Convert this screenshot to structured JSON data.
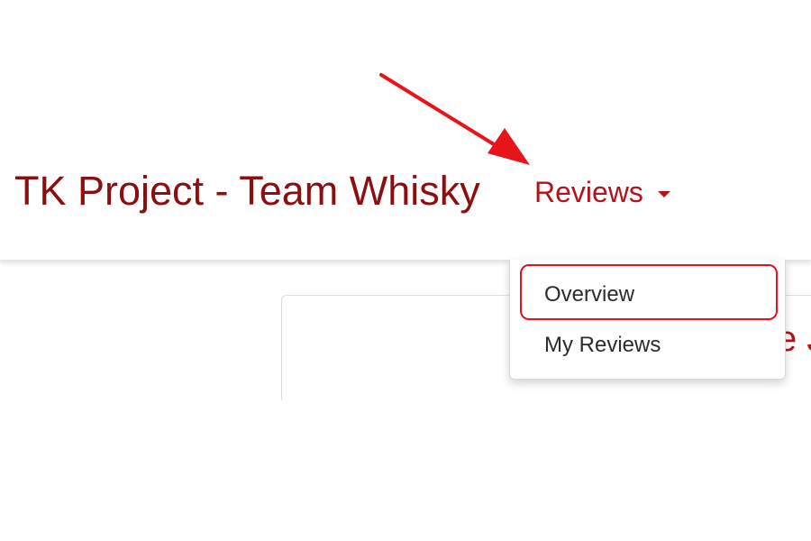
{
  "navbar": {
    "brand": "TK Project - Team Whisky",
    "reviews_menu": {
      "label": "Reviews",
      "items": [
        {
          "label": "Overview"
        },
        {
          "label": "My Reviews"
        }
      ]
    }
  },
  "content": {
    "title_fragment": "e J"
  },
  "colors": {
    "brand": "#8b0f10",
    "accent": "#b3131a",
    "highlight": "#e0141e",
    "arrow": "#e8141c"
  },
  "icons": {
    "menu_caret": "caret-down-icon"
  }
}
